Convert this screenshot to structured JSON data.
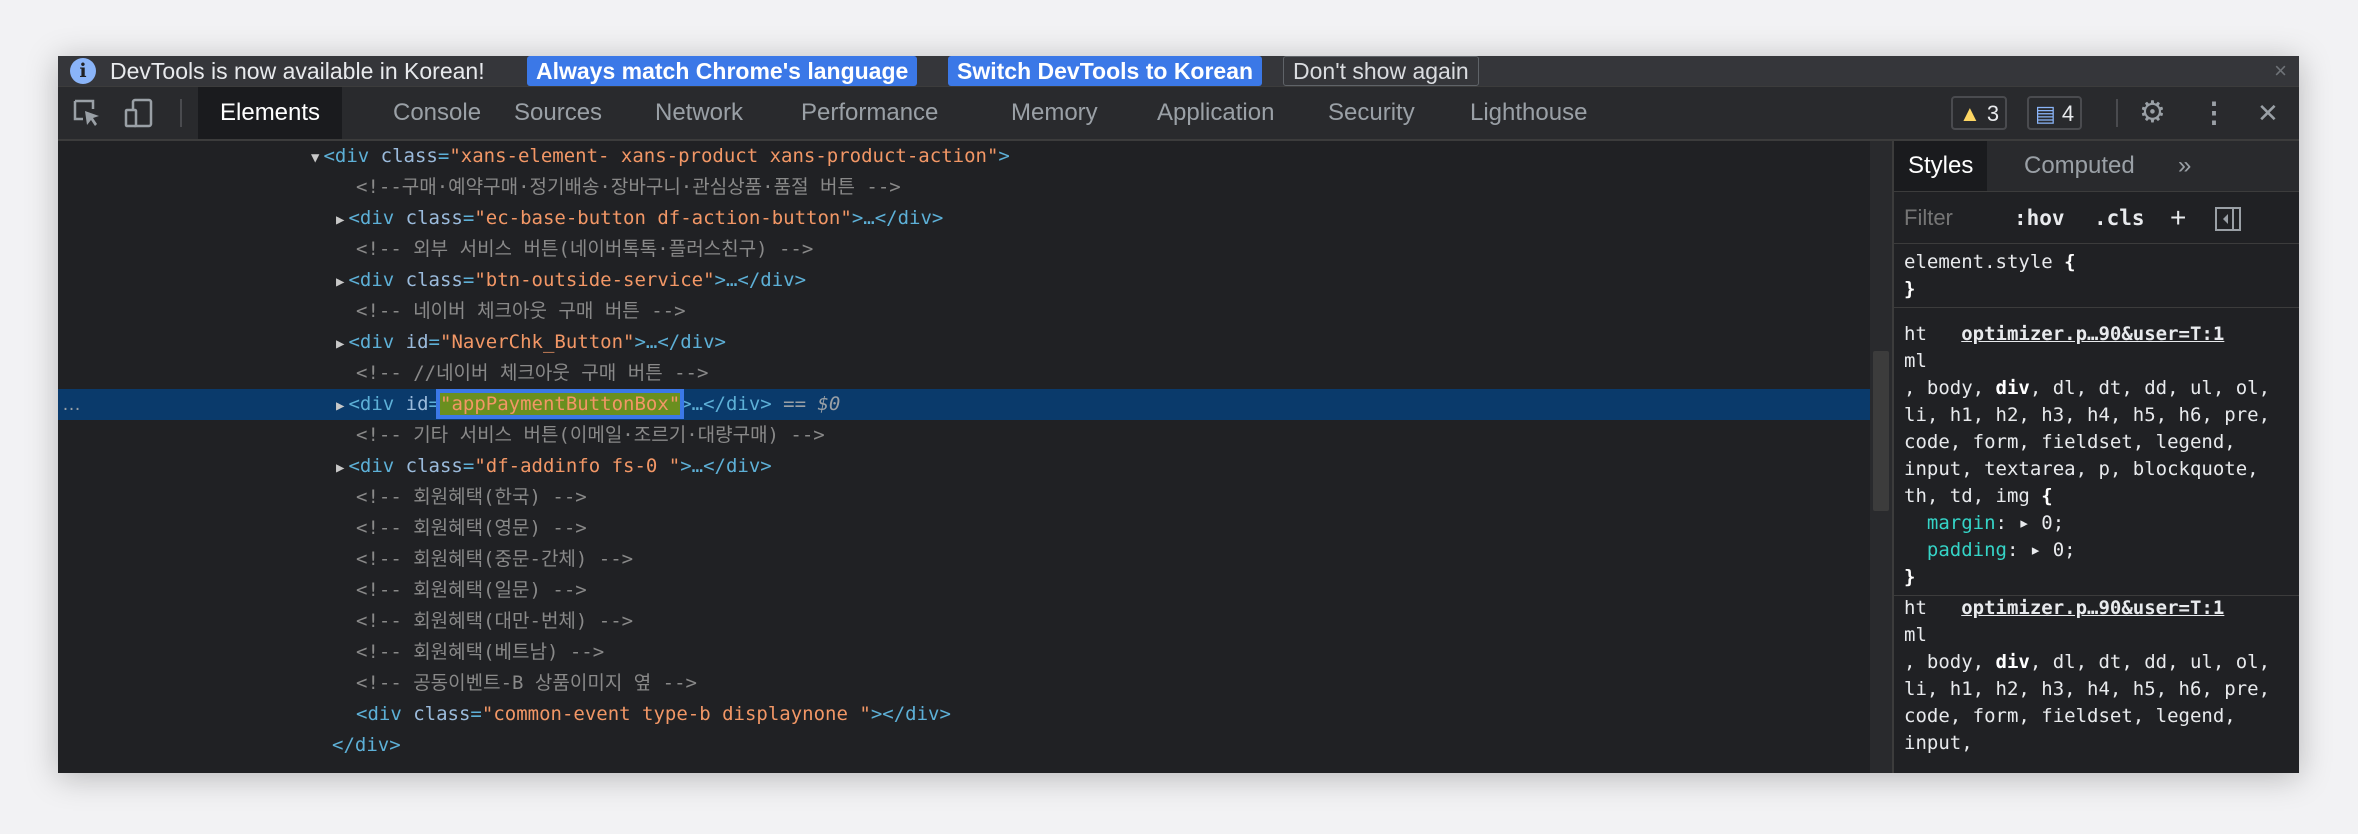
{
  "infobar": {
    "message": "DevTools is now available in Korean!",
    "btn_match": "Always match Chrome's language",
    "btn_switch": "Switch DevTools to Korean",
    "btn_dismiss": "Don't show again",
    "close": "×"
  },
  "tabs": {
    "elements": "Elements",
    "console": "Console",
    "sources": "Sources",
    "network": "Network",
    "performance": "Performance",
    "memory": "Memory",
    "application": "Application",
    "security": "Security",
    "lighthouse": "Lighthouse"
  },
  "badges": {
    "warnings": "3",
    "messages": "4",
    "warn_glyph": "▲",
    "msg_glyph": "▤"
  },
  "toolbar_icons": {
    "settings": "⚙",
    "more": "⋮",
    "close": "✕"
  },
  "dom": {
    "l0_tri": "▼",
    "l0_tag_open": "<div",
    "l0_attr": "class",
    "l0_val": "\"xans-element- xans-product xans-product-action\"",
    "l0_end": ">",
    "l1": "<!--구매·예약구매·정기배송·장바구니·관심상품·품절 버튼 -->",
    "l2_attr": "class",
    "l2_val": "\"ec-base-button df-action-button\"",
    "l2_end": ">…</div>",
    "l3": "<!-- 외부 서비스 버튼(네이버톡톡·플러스친구) -->",
    "l4_attr": "class",
    "l4_val": "\"btn-outside-service\"",
    "l4_end": ">…</div>",
    "l5": "<!-- 네이버 체크아웃 구매 버튼 -->",
    "l6_attr": "id",
    "l6_val": "\"NaverChk_Button\"",
    "l6_end": ">…</div>",
    "l7": "<!-- //네이버 체크아웃 구매 버튼 -->",
    "l8_dots": "…",
    "l8_attr": "id",
    "l8_eq": "=",
    "l8_val": "\"appPaymentButtonBox\"",
    "l8_end": ">…</div>",
    "l8_dollar": " == $0",
    "l9": "<!-- 기타 서비스 버튼(이메일·조르기·대량구매) -->",
    "l10_attr": "class",
    "l10_val": "\"df-addinfo fs-0 \"",
    "l10_end": ">…</div>",
    "l11": "<!-- 회원혜택(한국) -->",
    "l12": "<!-- 회원혜택(영문) -->",
    "l13": "<!-- 회원혜택(중문-간체) -->",
    "l14": "<!-- 회원혜택(일문) -->",
    "l15": "<!-- 회원혜택(대만-번체) -->",
    "l16": "<!-- 회원혜택(베트남) -->",
    "l17": "<!-- 공동이벤트-B 상품이미지 옆 -->",
    "l18_attr": "class",
    "l18_val": "\"common-event type-b displaynone \"",
    "l18_end": "></div>",
    "l19": "</div>",
    "tag_div": "<div",
    "tri_closed": "▶"
  },
  "styles": {
    "tab_styles": "Styles",
    "tab_computed": "Computed",
    "tab_more": "»",
    "filter_placeholder": "Filter",
    "hov": ":hov",
    "cls": ".cls",
    "plus": "+",
    "element_style": "element.style",
    "open_brace": "{",
    "close_brace": "}",
    "rule1_ht": "ht",
    "rule1_src": "optimizer.p…90&user=T:1",
    "rule1_ml": "ml",
    "rule1_sel_a": ", body, ",
    "rule1_sel_div": "div",
    "rule1_sel_b": ", dl, dt, dd, ul, ol, li, h1, h2, h3, h4, h5, h6, pre, code, form, fieldset, legend, input, textarea, p, blockquote, th, td, img",
    "margin": "margin",
    "padding": "padding",
    "zero": "0;",
    "rule2_ht": "ht",
    "rule2_src": "optimizer.p…90&user=T:1",
    "rule2_ml": "ml",
    "rule2_sel_a": ", body, ",
    "rule2_sel_div": "div",
    "rule2_sel_b": ", dl, dt, dd, ul, ol, li, h1, h2, h3, h4, h5, h6, pre, code, form, fieldset, legend, input,"
  }
}
